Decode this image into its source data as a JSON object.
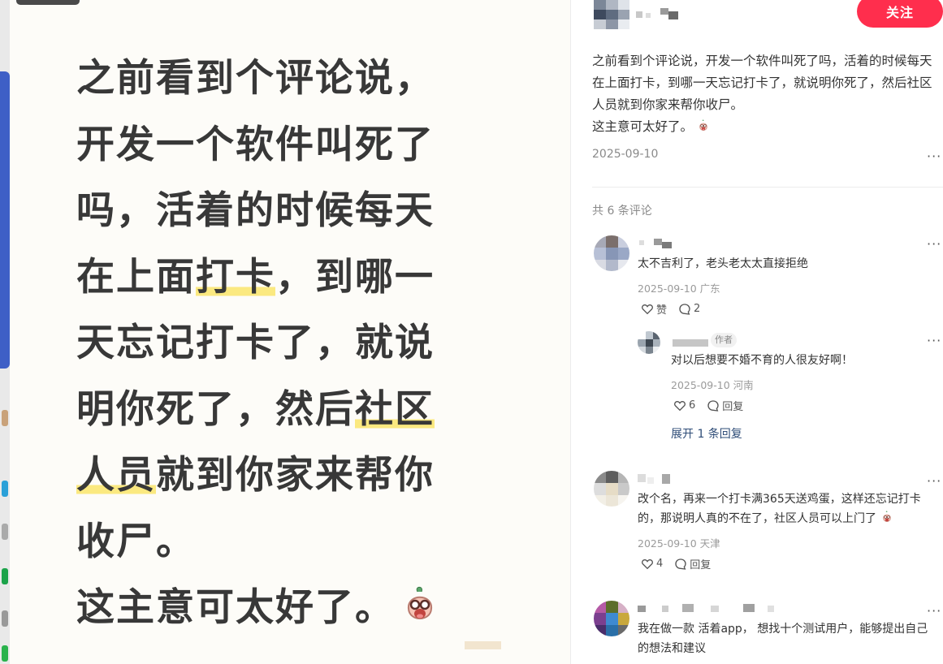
{
  "image": {
    "lines": [
      {
        "parts": [
          {
            "t": "之前看到个评论说，",
            "hl": false
          }
        ]
      },
      {
        "parts": [
          {
            "t": "开发一个软件叫死了",
            "hl": false
          }
        ]
      },
      {
        "parts": [
          {
            "t": "吗，活着的时候每天",
            "hl": false
          }
        ]
      },
      {
        "parts": [
          {
            "t": "在上面",
            "hl": false
          },
          {
            "t": "打卡",
            "hl": true
          },
          {
            "t": "，到哪一",
            "hl": false
          }
        ]
      },
      {
        "parts": [
          {
            "t": "天忘记打卡了，就说",
            "hl": false
          }
        ]
      },
      {
        "parts": [
          {
            "t": "明你死了，然后",
            "hl": false
          },
          {
            "t": "社区",
            "hl": true
          }
        ]
      },
      {
        "parts": [
          {
            "t": "人员",
            "hl": true
          },
          {
            "t": "就到你家来帮你",
            "hl": false
          }
        ]
      },
      {
        "parts": [
          {
            "t": "收尸。",
            "hl": false
          }
        ]
      },
      {
        "parts": [
          {
            "t": "这主意可太好了。",
            "hl": false
          }
        ],
        "emoji": true
      }
    ],
    "emoji_icon": "laughing-face-emoji-icon"
  },
  "header": {
    "follow_label": "关注"
  },
  "post": {
    "lines": [
      "之前看到个评论说，开发一个软件叫死了吗，活着的时候每天在上面打卡，到哪一天忘记打卡了，就说明你死了，然后社区人员就到你家来帮你收尸。",
      "这主意可太好了。"
    ],
    "date": "2025-09-10",
    "more": "···"
  },
  "comments_header": "共 6 条评论",
  "comments": [
    {
      "text": "太不吉利了，老头老太太直接拒绝",
      "meta": "2025-09-10 广东",
      "like_label": "赞",
      "reply_count": "2",
      "more": "···"
    },
    {
      "text": "对以后想要不婚不育的人很友好啊！",
      "meta": "2025-09-10 河南",
      "like_count": "6",
      "reply_label": "回复",
      "more": "···",
      "badge": "作者"
    },
    {
      "expand": "展开 1 条回复"
    },
    {
      "text": "改个名，再来一个打卡满365天送鸡蛋，这样还忘记打卡的，那说明人真的不在了，社区人员可以上门了",
      "meta": "2025-09-10 天津",
      "like_count": "4",
      "reply_label": "回复",
      "more": "···"
    },
    {
      "text": "我在做一款 活着app， 想找十个测试用户，能够提出自己的想法和建议",
      "more": "···"
    }
  ],
  "icons": {
    "like": "heart-outline-icon",
    "reply": "chat-bubble-icon",
    "more": "more-dots-icon"
  },
  "colors": {
    "accent": "#ff2e4d",
    "highlight": "#fbe980",
    "link": "#2e4c77",
    "backstrip_blue": "#3e5fc6"
  }
}
